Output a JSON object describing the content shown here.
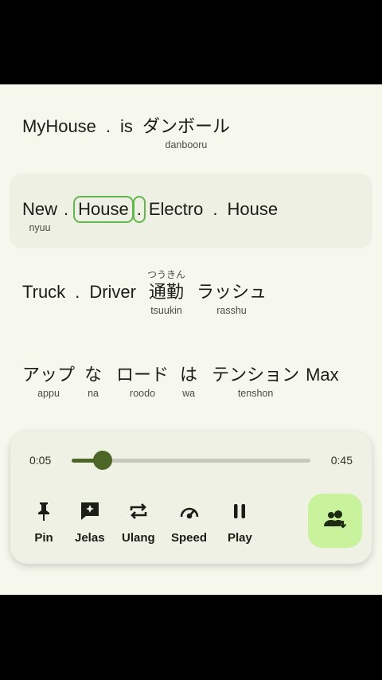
{
  "lyrics": {
    "line1": {
      "words": [
        {
          "text": "MyHouse",
          "romaji": ""
        },
        {
          "text": "is",
          "romaji": ""
        },
        {
          "text": "ダンボール",
          "romaji": "danbooru"
        }
      ]
    },
    "line2": {
      "words": [
        {
          "text": "New",
          "romaji": "nyuu"
        },
        {
          "text": "House",
          "romaji": ""
        },
        {
          "text": "Electro",
          "romaji": ""
        },
        {
          "text": "House",
          "romaji": ""
        }
      ]
    },
    "line3": {
      "words": [
        {
          "text": "Truck",
          "romaji": ""
        },
        {
          "text": "Driver",
          "romaji": ""
        },
        {
          "text": "通勤",
          "furigana": "つうきん",
          "romaji": "tsuukin"
        },
        {
          "text": "ラッシュ",
          "romaji": "rasshu"
        }
      ]
    },
    "line4": {
      "words": [
        {
          "text": "アップ",
          "romaji": "appu"
        },
        {
          "text": "な",
          "romaji": "na"
        },
        {
          "text": "ロード",
          "romaji": "roodo"
        },
        {
          "text": "は",
          "romaji": "wa"
        },
        {
          "text": "テンション",
          "romaji": "tenshon"
        },
        {
          "text": "Max",
          "romaji": ""
        }
      ]
    },
    "separator": "."
  },
  "player": {
    "current_time": "0:05",
    "total_time": "0:45",
    "progress_fraction": 0.13,
    "controls": [
      {
        "label": "Pin",
        "icon": "pin-icon"
      },
      {
        "label": "Jelas",
        "icon": "sparkle-chat-icon"
      },
      {
        "label": "Ulang",
        "icon": "repeat-icon"
      },
      {
        "label": "Speed",
        "icon": "speedometer-icon"
      },
      {
        "label": "Play",
        "icon": "pause-icon"
      }
    ],
    "fab_icon": "people-download-icon"
  },
  "colors": {
    "background": "#f6f8ee",
    "accent": "#4d6628",
    "highlight_outline": "#62b64f",
    "fab": "#c8f29b"
  }
}
